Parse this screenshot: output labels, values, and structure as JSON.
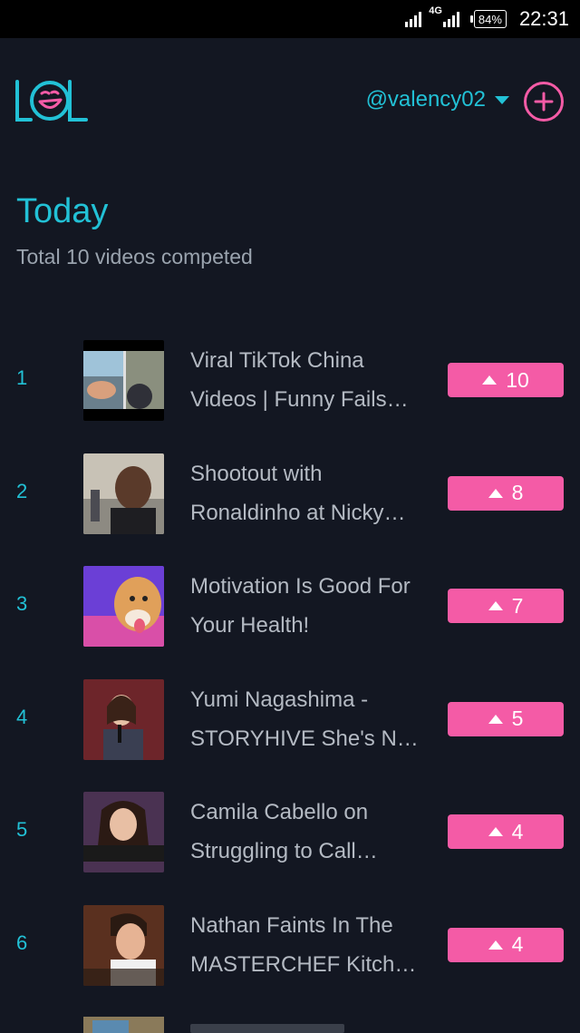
{
  "status_bar": {
    "network": "4G",
    "battery": "84%",
    "time": "22:31"
  },
  "header": {
    "logo_text": "LOL",
    "account": "@valency02"
  },
  "section": {
    "title": "Today",
    "subtitle": "Total 10 videos competed"
  },
  "videos": [
    {
      "rank": "1",
      "title_line1": "Viral TikTok China",
      "title_line2": "Videos | Funny Fails…",
      "votes": "10"
    },
    {
      "rank": "2",
      "title_line1": "Shootout with",
      "title_line2": "Ronaldinho at Nicky…",
      "votes": "8"
    },
    {
      "rank": "3",
      "title_line1": "Motivation Is Good For",
      "title_line2": "Your Health!",
      "votes": "7"
    },
    {
      "rank": "4",
      "title_line1": "Yumi Nagashima -",
      "title_line2": "STORYHIVE She's No…",
      "votes": "5"
    },
    {
      "rank": "5",
      "title_line1": "Camila Cabello on",
      "title_line2": "Struggling to Call…",
      "votes": "4"
    },
    {
      "rank": "6",
      "title_line1": "Nathan Faints In The",
      "title_line2": "MASTERCHEF Kitch…",
      "votes": "4"
    }
  ],
  "colors": {
    "background": "#131722",
    "accent_cyan": "#22c1d6",
    "accent_pink": "#f45ba6"
  }
}
